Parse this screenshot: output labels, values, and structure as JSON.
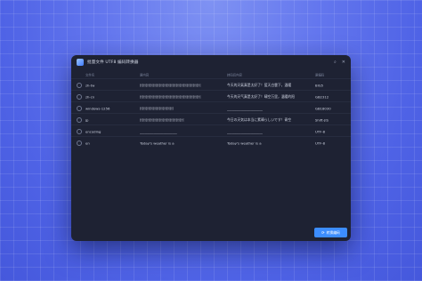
{
  "window": {
    "title": "批量文件 UTF8 编码转换器",
    "search_icon": "search-icon",
    "close_icon": "close-icon"
  },
  "table": {
    "columns": [
      "文件名",
      "原内容",
      "转码后内容",
      "原编码"
    ],
    "rows": [
      {
        "file": "zh-tw",
        "original": "\u0002\u0002\u0002\u0002\u0002\u0002\u0002\u0002\u0002\u0002\u0002\u0002\u0002\u0002\u0002\u0002\u0002\u0002",
        "converted": "今天的天氣真是太好了！藍天白雲下，溫暖",
        "encoding": "BIG5"
      },
      {
        "file": "zh-cn",
        "original": "\u0002\u0002\u0002\u0002\u0002\u0002\u0002\u0002\u0002\u0002\u0002\u0002\u0002\u0002\u0002\u0002\u0002\u0002",
        "converted": "今天的天气真是太好了！晴空万里，温暖的阳",
        "encoding": "GB2312"
      },
      {
        "file": "windows-1256",
        "original": "\u0002\u0002\u0002\u0002\u0002\u0002\u0002\u0002\u0002\u0002",
        "converted": "_____________________",
        "encoding": "GB18030"
      },
      {
        "file": "jp",
        "original": "\u0002\u0002\u0002\u0002\u0002\u0002\u0002\u0002\u0002\u0002\u0002\u0002\u0002",
        "converted": "今日の天気は本当に素晴らしいです！青空",
        "encoding": "Shift-JIS"
      },
      {
        "file": "encoding",
        "original": "______________________",
        "converted": "_____________________",
        "encoding": "UTF-8"
      },
      {
        "file": "en",
        "original": "Today's weather is a",
        "converted": "Today's weather is a",
        "encoding": "UTF-8"
      }
    ]
  },
  "footer": {
    "convert_label": "转换编码",
    "convert_icon": "refresh-icon"
  }
}
